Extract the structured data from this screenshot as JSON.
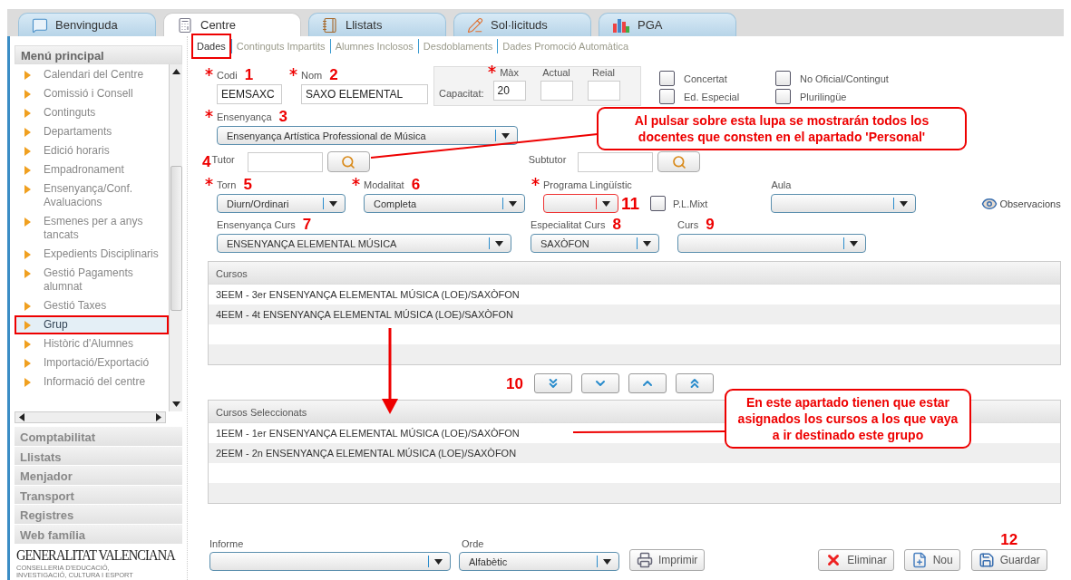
{
  "tabs": [
    {
      "label": "Benvinguda",
      "kind": "chat",
      "selected": false
    },
    {
      "label": "Centre",
      "kind": "grid",
      "selected": true
    },
    {
      "label": "Llistats",
      "kind": "notebook",
      "selected": false
    },
    {
      "label": "Sol·licituds",
      "kind": "pencil",
      "selected": false
    },
    {
      "label": "PGA",
      "kind": "chart",
      "selected": false
    }
  ],
  "subtabs": [
    {
      "label": "Dades",
      "selected": true,
      "highlighted": true
    },
    {
      "label": "Continguts Impartits",
      "selected": false,
      "highlighted": false
    },
    {
      "label": "Alumnes Inclosos",
      "selected": false,
      "highlighted": false
    },
    {
      "label": "Desdoblaments",
      "selected": false,
      "highlighted": false
    },
    {
      "label": "Dades Promoció Automàtica",
      "selected": false,
      "highlighted": false
    }
  ],
  "sidebar": {
    "title": "Menú principal",
    "items": [
      {
        "label": "Calendari del Centre",
        "selected": false,
        "highlighted": false
      },
      {
        "label": "Comissió i Consell",
        "selected": false,
        "highlighted": false
      },
      {
        "label": "Continguts",
        "selected": false,
        "highlighted": false
      },
      {
        "label": "Departaments",
        "selected": false,
        "highlighted": false
      },
      {
        "label": "Edició horaris",
        "selected": false,
        "highlighted": false
      },
      {
        "label": "Empadronament",
        "selected": false,
        "highlighted": false
      },
      {
        "label": "Ensenyança/Conf. Avaluacions",
        "selected": false,
        "highlighted": false
      },
      {
        "label": "Esmenes per a anys tancats",
        "selected": false,
        "highlighted": false
      },
      {
        "label": "Expedients Disciplinaris",
        "selected": false,
        "highlighted": false
      },
      {
        "label": "Gestió Pagaments alumnat",
        "selected": false,
        "highlighted": false
      },
      {
        "label": "Gestió Taxes",
        "selected": false,
        "highlighted": false
      },
      {
        "label": "Grup",
        "selected": true,
        "highlighted": true
      },
      {
        "label": "Històric d'Alumnes",
        "selected": false,
        "highlighted": false
      },
      {
        "label": "Importació/Exportació",
        "selected": false,
        "highlighted": false
      },
      {
        "label": "Informació del centre",
        "selected": false,
        "highlighted": false
      }
    ],
    "sections": [
      "Comptabilitat",
      "Llistats",
      "Menjador",
      "Transport",
      "Registres",
      "Web família"
    ],
    "logo": {
      "name": "GENERALITAT VALENCIANA",
      "subtitle": "CONSELLERIA D'EDUCACIÓ, INVESTIGACIÓ, CULTURA I ESPORT"
    }
  },
  "form": {
    "codi": {
      "label": "Codi",
      "value": "EEMSAXC",
      "required": true,
      "marker": "1"
    },
    "nom": {
      "label": "Nom",
      "value": "SAXO ELEMENTAL",
      "required": true,
      "marker": "2"
    },
    "capacity": {
      "label": "Capacitat:",
      "fields": [
        {
          "label": "Màx",
          "value": "20",
          "required": true
        },
        {
          "label": "Actual",
          "required": false
        },
        {
          "label": "Reial",
          "required": false
        }
      ]
    },
    "flags": [
      {
        "label": "Concertat",
        "checked": false
      },
      {
        "label": "No Oficial/Contingut",
        "checked": false
      },
      {
        "label": "Ed. Especial",
        "checked": false
      },
      {
        "label": "Plurilingüe",
        "checked": false
      }
    ],
    "ensenyanca": {
      "label": "Ensenyança",
      "value": "Ensenyança Artística Professional de Música",
      "required": true,
      "marker": "3"
    },
    "tutor": {
      "label": "Tutor",
      "marker": "4"
    },
    "subtutor": {
      "label": "Subtutor"
    },
    "torn": {
      "label": "Torn",
      "value": "Diurn/Ordinari",
      "required": true,
      "marker": "5"
    },
    "modalitat": {
      "label": "Modalitat",
      "value": "Completa",
      "required": true,
      "marker": "6"
    },
    "programa": {
      "label": "Programa Lingüístic",
      "required": true,
      "invalid": true,
      "marker": "11"
    },
    "pl_mixt": {
      "label": "P.L.Mixt",
      "checked": false
    },
    "aula": {
      "label": "Aula",
      "required": false
    },
    "observacions": {
      "label": "Observacions"
    },
    "ensenyanca_curs": {
      "label": "Ensenyança Curs",
      "value": "ENSENYANÇA ELEMENTAL MÚSICA",
      "required": false,
      "marker": "7"
    },
    "especialitat": {
      "label": "Especialitat Curs",
      "value": "SAXÒFON",
      "required": false,
      "marker": "8"
    },
    "curs": {
      "label": "Curs",
      "required": false,
      "marker": "9"
    }
  },
  "courses": {
    "title": "Cursos",
    "rows": [
      "3EEM - 3er ENSENYANÇA ELEMENTAL MÚSICA (LOE)/SAXÒFON",
      "4EEM - 4t ENSENYANÇA ELEMENTAL MÚSICA (LOE)/SAXÒFON"
    ]
  },
  "move_buttons": {
    "marker": "10",
    "buttons": [
      {
        "kind": "all-down"
      },
      {
        "kind": "down"
      },
      {
        "kind": "up"
      },
      {
        "kind": "all-up"
      }
    ]
  },
  "selected_courses": {
    "title": "Cursos Seleccionats",
    "rows": [
      "1EEM - 1er ENSENYANÇA ELEMENTAL MÚSICA (LOE)/SAXÒFON",
      "2EEM - 2n ENSENYANÇA ELEMENTAL MÚSICA (LOE)/SAXÒFON"
    ]
  },
  "footer": {
    "informe": {
      "label": "Informe"
    },
    "orde": {
      "label": "Orde",
      "value": "Alfabètic"
    },
    "print": "Imprimir",
    "actions": [
      {
        "label": "Eliminar",
        "kind": "delete"
      },
      {
        "label": "Nou",
        "kind": "new"
      },
      {
        "label": "Guardar",
        "kind": "save",
        "marker": "12"
      }
    ]
  },
  "callouts": [
    {
      "text": "Al pulsar sobre esta lupa se mostrarán todos los docentes que consten en el apartado 'Personal'"
    },
    {
      "text": "En este apartado tienen que estar asignados los cursos a los que vaya a ir destinado este grupo"
    }
  ]
}
